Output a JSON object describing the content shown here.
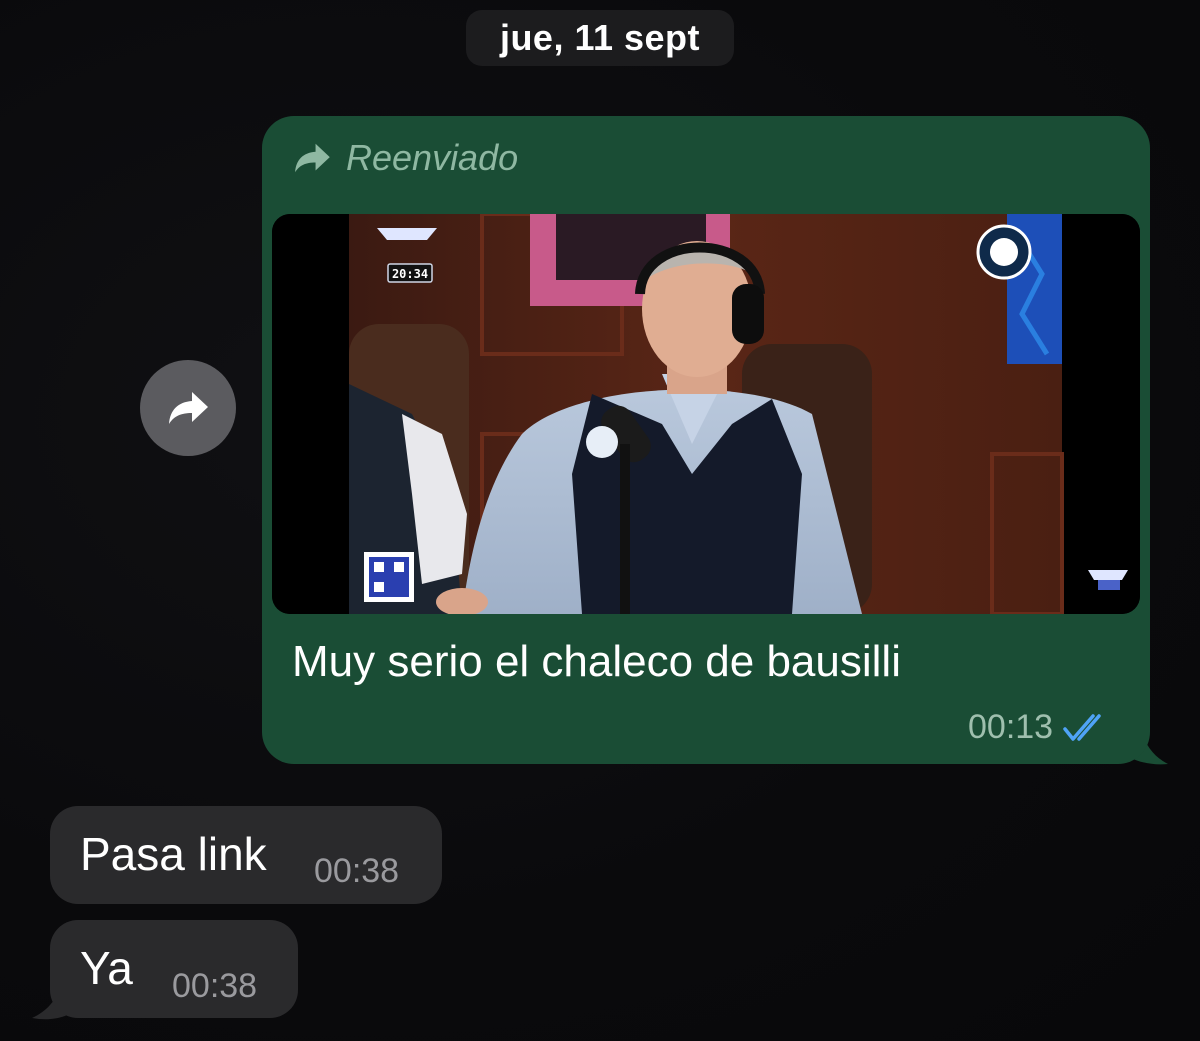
{
  "date_separator": "jue, 11 sept",
  "outgoing_message": {
    "forwarded_label": "Reenviado",
    "caption": "Muy serio el chaleco de bausilli",
    "time": "00:13",
    "status": "read",
    "status_icon": "double-check-icon",
    "colors": {
      "bubble": "#1a4d35",
      "read_ticks": "#4fa3f7"
    },
    "video_overlay": {
      "clock": "20:34"
    }
  },
  "incoming_messages": [
    {
      "text": "Pasa link",
      "time": "00:38"
    },
    {
      "text": "Ya",
      "time": "00:38"
    }
  ],
  "forward_action_icon": "forward-arrow-icon"
}
